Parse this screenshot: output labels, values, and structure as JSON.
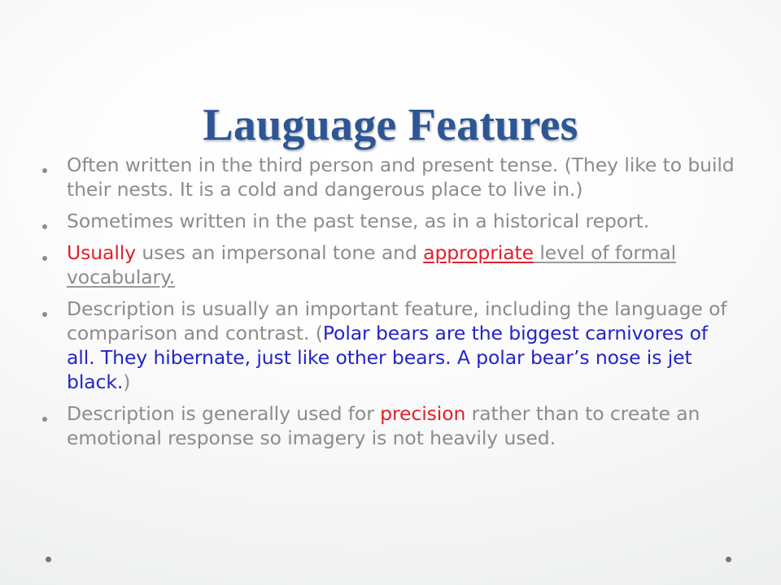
{
  "slide": {
    "title": "Lauguage Features",
    "bullet_marker": "•",
    "colors": {
      "title": "#2d5694",
      "body_text": "#8c8c8c",
      "accent_red": "#e0202b",
      "accent_blue": "#2424c8",
      "bullet_dot": "#8d8d8d",
      "background_edge": "#e7e8e9",
      "background_center": "#ffffff"
    },
    "bullets": [
      {
        "id": "bullet-1",
        "plain_text": "Often written in the third person and present tense. (They like to build their nests. It is a cold and dangerous place to live in.)",
        "runs": [
          {
            "text": "Often written in the third person and present tense. (They like to build their nests. It is a cold and dangerous place to live in.)",
            "style": "plain"
          }
        ]
      },
      {
        "id": "bullet-2",
        "plain_text": "Sometimes written in the past tense, as in a historical report.",
        "runs": [
          {
            "text": "Sometimes written in the past tense, as in a historical report.",
            "style": "plain"
          }
        ]
      },
      {
        "id": "bullet-3",
        "plain_text": "Usually uses an impersonal tone and appropriate level of formal vocabulary.",
        "runs": [
          {
            "text": "Usually",
            "style": "red"
          },
          {
            "text": " uses an impersonal tone and ",
            "style": "plain"
          },
          {
            "text": "appropriate",
            "style": "red-underline"
          },
          {
            "text": " level of formal vocabulary.",
            "style": "grey-underline"
          }
        ]
      },
      {
        "id": "bullet-4",
        "plain_text": "Description is usually an important feature, including the language of comparison and contrast. (Polar bears are the biggest carnivores of all. They hibernate, just like other bears. A polar bear’s nose is jet black.)",
        "runs": [
          {
            "text": "Description is usually an important feature, including the language of comparison and contrast. (",
            "style": "plain"
          },
          {
            "text": "Polar bears are the biggest carnivores of all. They hibernate, just like other bears. A polar bear’s nose is jet black.",
            "style": "blue"
          },
          {
            "text": ")",
            "style": "plain"
          }
        ]
      },
      {
        "id": "bullet-5",
        "plain_text": "Description is generally used for precision rather than to create an emotional response so imagery is not heavily used.",
        "runs": [
          {
            "text": "Description is generally used for ",
            "style": "plain"
          },
          {
            "text": "precision",
            "style": "red"
          },
          {
            "text": " rather than to create an emotional response so imagery is not heavily used.",
            "style": "plain"
          }
        ]
      }
    ],
    "footer_placeholder_bullets": 2
  }
}
